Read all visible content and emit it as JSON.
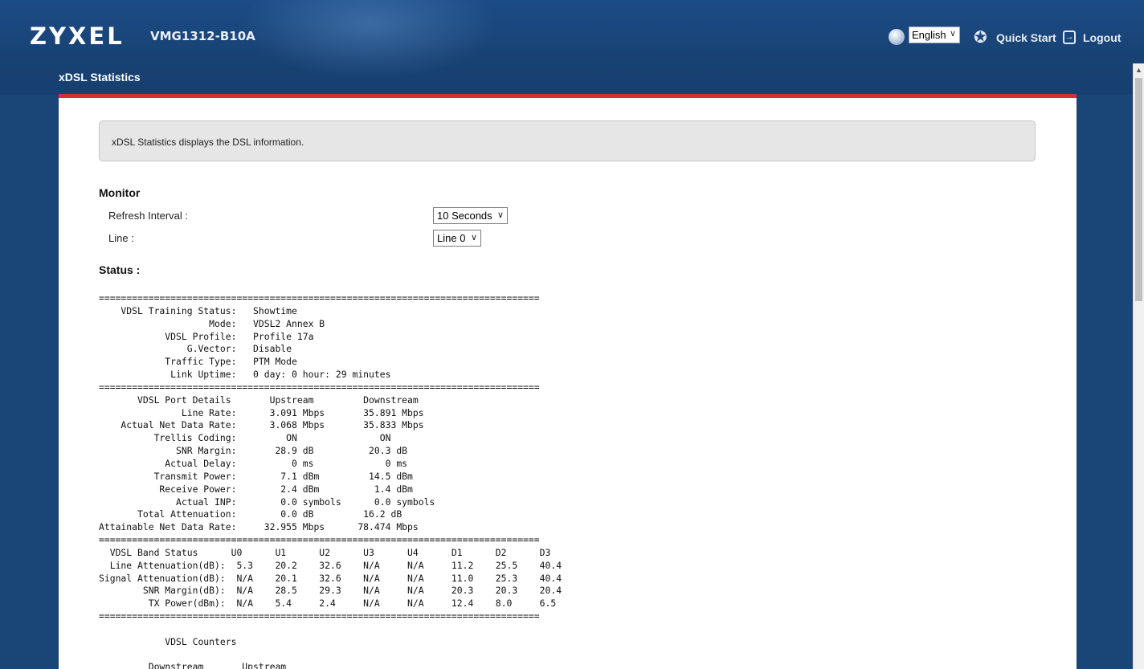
{
  "header": {
    "logo": "ZYXEL",
    "model": "VMG1312-B10A",
    "language": "English",
    "quick_start": "Quick Start",
    "logout": "Logout"
  },
  "page": {
    "title": "xDSL Statistics",
    "description": "xDSL Statistics displays the DSL information."
  },
  "monitor": {
    "title": "Monitor",
    "refresh_label": "Refresh Interval :",
    "refresh_value": "10 Seconds",
    "line_label": "Line :",
    "line_value": "Line 0"
  },
  "status": {
    "title": "Status :",
    "text": "================================================================================\n    VDSL Training Status:   Showtime\n                    Mode:   VDSL2 Annex B\n            VDSL Profile:   Profile 17a\n                G.Vector:   Disable\n            Traffic Type:   PTM Mode\n             Link Uptime:   0 day: 0 hour: 29 minutes\n================================================================================\n       VDSL Port Details       Upstream         Downstream\n               Line Rate:      3.091 Mbps       35.891 Mbps\n    Actual Net Data Rate:      3.068 Mbps       35.833 Mbps\n          Trellis Coding:         ON               ON\n              SNR Margin:       28.9 dB          20.3 dB\n            Actual Delay:          0 ms             0 ms\n          Transmit Power:        7.1 dBm         14.5 dBm\n           Receive Power:        2.4 dBm          1.4 dBm\n              Actual INP:        0.0 symbols      0.0 symbols\n       Total Attenuation:        0.0 dB         16.2 dB\nAttainable Net Data Rate:     32.955 Mbps      78.474 Mbps\n================================================================================\n  VDSL Band Status      U0      U1      U2      U3      U4      D1      D2      D3\n  Line Attenuation(dB):  5.3    20.2    32.6    N/A     N/A     11.2    25.5    40.4\nSignal Attenuation(dB):  N/A    20.1    32.6    N/A     N/A     11.0    25.3    40.4\n        SNR Margin(dB):  N/A    28.5    29.3    N/A     N/A     20.3    20.3    20.4\n         TX Power(dBm):  N/A    5.4     2.4     N/A     N/A     12.4    8.0     6.5\n================================================================================\n\n            VDSL Counters\n\n         Downstream       Upstream"
  },
  "colors": {
    "header_bg": "#1a4577",
    "accent": "#d62d3a",
    "info_bg": "#e6e6e6"
  }
}
